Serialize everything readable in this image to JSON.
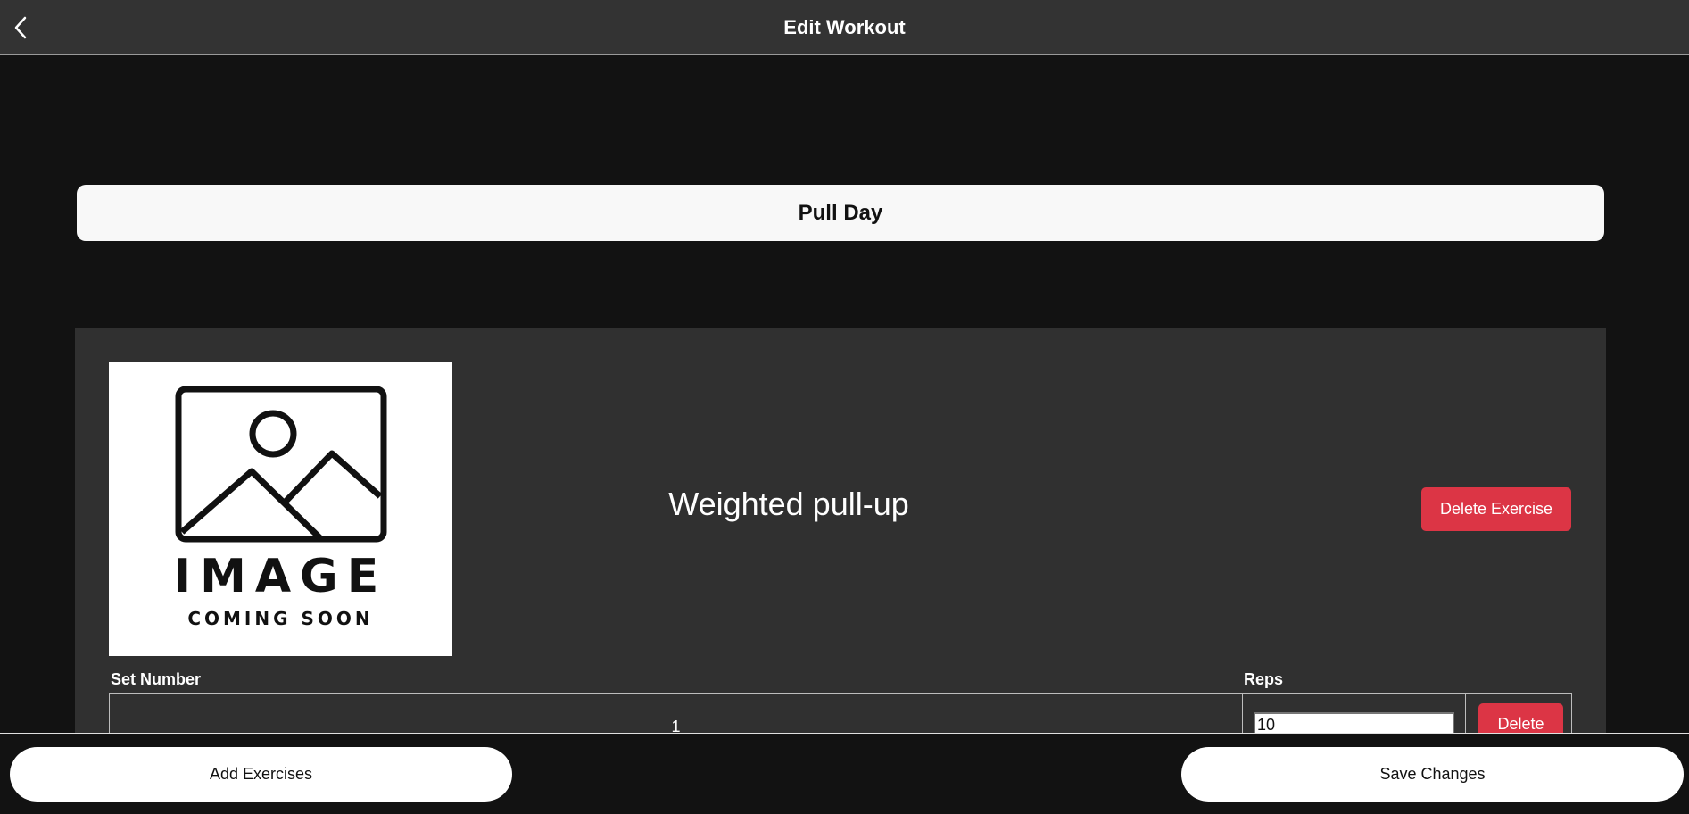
{
  "header": {
    "title": "Edit Workout",
    "back_icon": "chevron-left-icon"
  },
  "workout": {
    "name": "Pull Day"
  },
  "exercise": {
    "image": {
      "icon": "image-placeholder-icon",
      "big_text": "IMAGE",
      "small_text": "COMING SOON"
    },
    "name": "Weighted pull-up",
    "delete_label": "Delete Exercise",
    "sets_table": {
      "columns": [
        "Set Number",
        "Reps"
      ],
      "rows": [
        {
          "set_number": "1",
          "reps": "10",
          "delete_label": "Delete"
        }
      ]
    }
  },
  "footer": {
    "add_label": "Add Exercises",
    "save_label": "Save Changes"
  },
  "colors": {
    "background": "#121212",
    "header": "#333333",
    "card": "#303030",
    "danger": "#dc3545"
  }
}
